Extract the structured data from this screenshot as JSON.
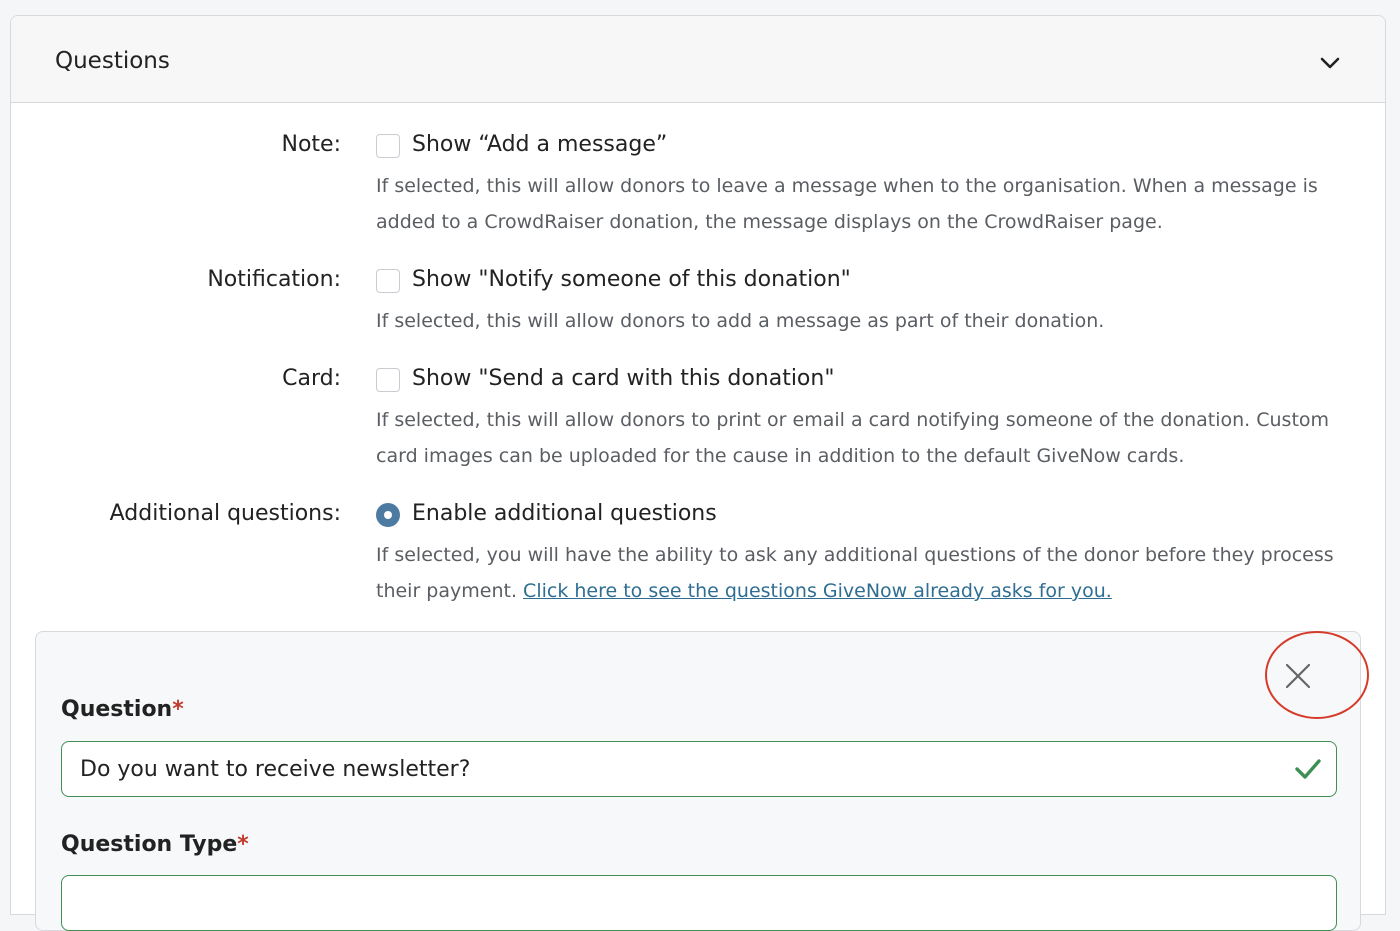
{
  "panel": {
    "title": "Questions"
  },
  "rows": {
    "note": {
      "label": "Note:",
      "option": "Show “Add a message”",
      "help": "If selected, this will allow donors to leave a message when to the organisation. When a message is added to a CrowdRaiser donation, the message displays on the CrowdRaiser page."
    },
    "notification": {
      "label": "Notification:",
      "option": "Show \"Notify someone of this donation\"",
      "help": "If selected, this will allow donors to add a message as part of their donation."
    },
    "card": {
      "label": "Card:",
      "option": "Show \"Send a card with this donation\"",
      "help": "If selected, this will allow donors to print or email a card notifying someone of the donation. Custom card images can be uploaded for the cause in addition to the default GiveNow cards."
    },
    "additional": {
      "label": "Additional questions:",
      "option": "Enable additional questions",
      "help": "If selected, you will have the ability to ask any additional questions of the donor before they process their payment.",
      "link": "Click here to see the questions GiveNow already asks for you."
    }
  },
  "question_form": {
    "question_label": "Question",
    "question_value": "Do you want to receive newsletter?",
    "type_label": "Question Type",
    "required_mark": "*"
  },
  "colors": {
    "accent": "#4d7aa0",
    "valid": "#3f8f55",
    "link": "#2f6e92",
    "highlight_ring": "#d63b2a"
  }
}
